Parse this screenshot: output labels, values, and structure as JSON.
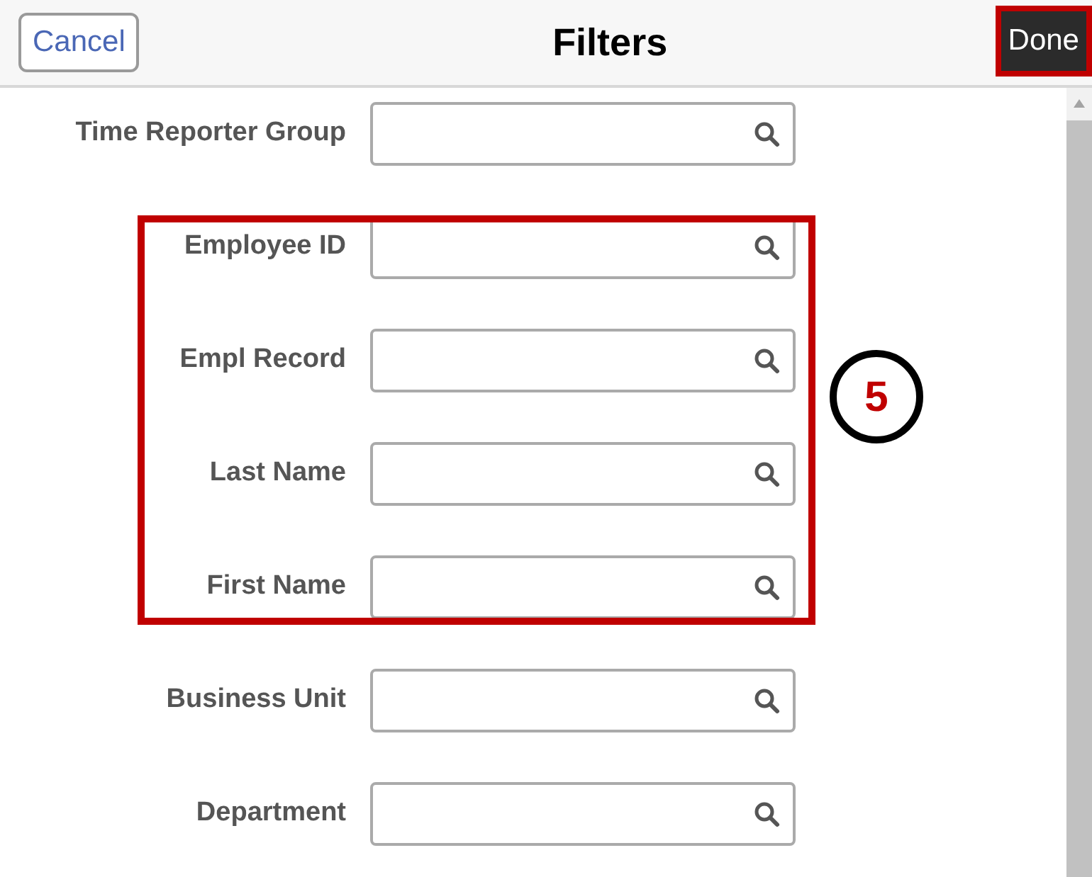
{
  "header": {
    "title": "Filters",
    "cancel": "Cancel",
    "done": {
      "label": "Done",
      "highlighted": true
    }
  },
  "filters": [
    {
      "label": "Time Reporter Group",
      "highlighted": false
    },
    {
      "label": "Employee ID",
      "highlighted": true
    },
    {
      "label": "Empl Record",
      "highlighted": true
    },
    {
      "label": "Last Name",
      "highlighted": true
    },
    {
      "label": "First Name",
      "highlighted": true
    },
    {
      "label": "Business Unit",
      "highlighted": false
    },
    {
      "label": "Department",
      "highlighted": false
    }
  ],
  "callout": {
    "number": "5"
  }
}
